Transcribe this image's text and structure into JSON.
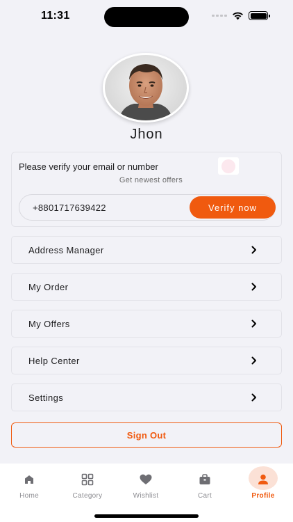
{
  "status_bar": {
    "time": "11:31"
  },
  "profile": {
    "name": "Jhon"
  },
  "verify": {
    "title": "Please verify your email or number",
    "subtitle": "Get newest offers",
    "phone": "+8801717639422",
    "button": "Verify now"
  },
  "menu": [
    {
      "label": "Address Manager"
    },
    {
      "label": "My Order"
    },
    {
      "label": "My Offers"
    },
    {
      "label": "Help Center"
    },
    {
      "label": "Settings"
    }
  ],
  "signout": {
    "label": "Sign Out"
  },
  "tabs": [
    {
      "label": "Home",
      "icon": "home-icon"
    },
    {
      "label": "Category",
      "icon": "grid-icon"
    },
    {
      "label": "Wishlist",
      "icon": "heart-icon"
    },
    {
      "label": "Cart",
      "icon": "bag-icon"
    },
    {
      "label": "Profile",
      "icon": "person-icon",
      "active": true
    }
  ],
  "colors": {
    "accent": "#f05a0f",
    "background": "#f2f2f7",
    "tab_inactive": "#8e8e93"
  }
}
